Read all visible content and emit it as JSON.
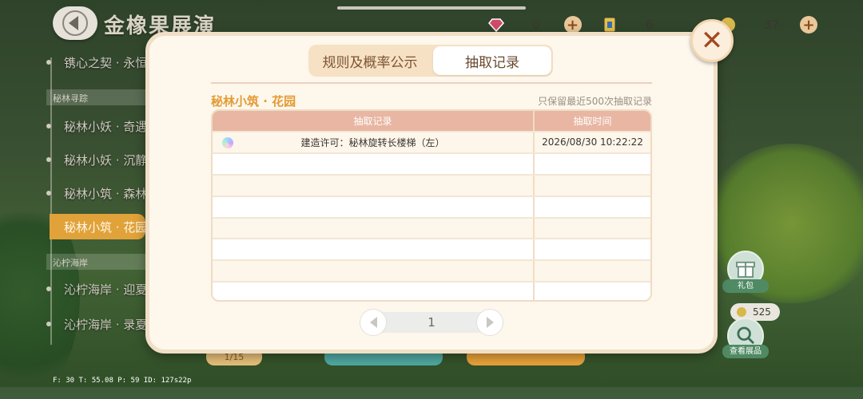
{
  "header": {
    "title": "金橡果展演",
    "back_icon": "back-arrow-icon"
  },
  "currency": [
    {
      "icon": "heart-gem-icon",
      "value": "0",
      "color": "#d04a6a"
    },
    {
      "icon": "ticket-icon",
      "value": "6",
      "color": "#e4c04a"
    },
    {
      "icon": "star-coin-icon",
      "value": "37",
      "color": "#d8b84a"
    }
  ],
  "sidebar": {
    "items": [
      {
        "type": "item",
        "label": "镌心之契 · 永恒"
      },
      {
        "type": "group",
        "label": "秘林寻踪"
      },
      {
        "type": "item",
        "label": "秘林小妖 · 奇遇"
      },
      {
        "type": "item",
        "label": "秘林小妖 · 沉静"
      },
      {
        "type": "item",
        "label": "秘林小筑 · 森林"
      },
      {
        "type": "active",
        "label": "秘林小筑 · 花园"
      },
      {
        "type": "group",
        "label": "沁柠海岸"
      },
      {
        "type": "item",
        "label": "沁柠海岸 · 迎夏"
      },
      {
        "type": "item",
        "label": "沁柠海岸 · 录夏"
      }
    ]
  },
  "modal": {
    "tabs": [
      {
        "label": "规则及概率公示",
        "active": false
      },
      {
        "label": "抽取记录",
        "active": true
      }
    ],
    "pool_name": "秘林小筑 · 花园",
    "note": "只保留最近500次抽取记录",
    "table": {
      "headers": [
        "抽取记录",
        "抽取时间"
      ],
      "rows": [
        {
          "item": "建造许可：秘林旋转长楼梯（左）",
          "time": "2026/08/30 10:22:22"
        },
        {
          "item": "",
          "time": ""
        },
        {
          "item": "",
          "time": ""
        },
        {
          "item": "",
          "time": ""
        },
        {
          "item": "",
          "time": ""
        },
        {
          "item": "",
          "time": ""
        },
        {
          "item": "",
          "time": ""
        },
        {
          "item": "",
          "time": ""
        }
      ]
    },
    "pager": {
      "page": "1"
    }
  },
  "right_panel": {
    "gift_label": "礼包",
    "coins": "525",
    "view_label": "查看展品"
  },
  "bottom": {
    "counter": "1/15"
  },
  "debug": "F: 30   T: 55.08   P: 59   ID: 127s22p"
}
